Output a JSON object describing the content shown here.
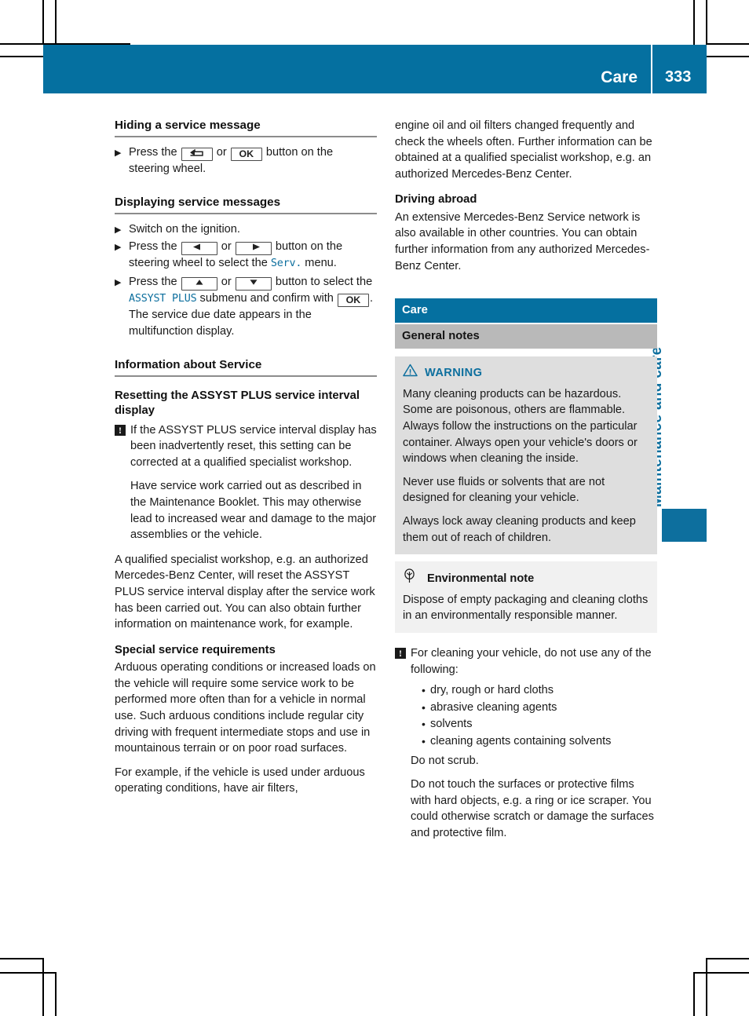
{
  "header": {
    "chapter_title": "Care",
    "page_number": "333",
    "band_color": "#0570a0"
  },
  "side_tab": {
    "label": "Maintenance and care",
    "color": "#0d6f9e"
  },
  "left_column": {
    "heading_hiding": "Hiding a service message",
    "step_hiding": {
      "text_1": "Press the",
      "button_back": "back-button",
      "text_or": "or",
      "button_ok": "OK",
      "text_2": "button on the steering wheel."
    },
    "heading_displaying": "Displaying service messages",
    "step_ignition": "Switch on the ignition.",
    "step_leftright": {
      "text_1": "Press the",
      "text_or": "or",
      "text_2": "button on the steering wheel to select the",
      "menu_name": "Serv.",
      "text_3": "menu."
    },
    "step_updown": {
      "text_1": "Press the",
      "text_or": "or",
      "text_2": "button to select the",
      "submenu_name": "ASSYST PLUS",
      "text_3": "submenu and confirm with",
      "button_ok": "OK",
      "text_4": "."
    },
    "step_result": "The service due date appears in the multifunction display.",
    "heading_information": "Information about Service",
    "heading_resetting": "Resetting the ASSYST PLUS service interval display",
    "notice_reset_p1": "If the ASSYST PLUS service interval display has been inadvertently reset, this setting can be corrected at a qualified specialist workshop.",
    "notice_reset_p2": "Have service work carried out as described in the Maintenance Booklet. This may otherwise lead to increased wear and damage to the major assemblies or the vehicle.",
    "para_qualified": "A qualified specialist workshop, e.g. an authorized Mercedes-Benz Center, will reset the ASSYST PLUS service interval display after the service work has been carried out. You can also obtain further information on maintenance work, for example.",
    "heading_special": "Special service requirements",
    "para_arduous": "Arduous operating conditions or increased loads on the vehicle will require some service work to be performed more often than for a vehicle in normal use. Such arduous conditions include regular city driving with frequent intermediate stops and use in mountainous terrain or on poor road surfaces.",
    "para_example": "For example, if the vehicle is used under arduous operating conditions, have air filters,"
  },
  "right_column": {
    "para_continued": "engine oil and oil filters changed frequently and check the wheels often. Further information can be obtained at a qualified specialist workshop, e.g. an authorized Mercedes-Benz Center.",
    "heading_driving_abroad": "Driving abroad",
    "para_driving_abroad": "An extensive Mercedes-Benz Service network is also available in other countries. You can obtain further information from any authorized Mercedes-Benz Center.",
    "section_care": "Care",
    "section_general_notes": "General notes",
    "warning": {
      "title": "WARNING",
      "icon": "warning-triangle-icon",
      "p1": "Many cleaning products can be hazardous. Some are poisonous, others are flammable. Always follow the instructions on the particular container. Always open your vehicle's doors or windows when cleaning the inside.",
      "p2": "Never use fluids or solvents that are not designed for cleaning your vehicle.",
      "p3": "Always lock away cleaning products and keep them out of reach of children."
    },
    "environmental": {
      "title": "Environmental note",
      "icon": "tree-icon",
      "p1": "Dispose of empty packaging and cleaning cloths in an environmentally responsible manner."
    },
    "notice_cleaning": {
      "intro": "For cleaning your vehicle, do not use any of the following:",
      "bullets": [
        "dry, rough or hard cloths",
        "abrasive cleaning agents",
        "solvents",
        "cleaning agents containing solvents"
      ],
      "p_scrub": "Do not scrub.",
      "p_touch": "Do not touch the surfaces or protective films with hard objects, e.g. a ring or ice scraper. You could otherwise scratch or damage the surfaces and protective film."
    }
  },
  "symbols": {
    "step_marker": "▶",
    "notice_mark": "!",
    "bullet_dot": "•",
    "ok_label": "OK"
  }
}
